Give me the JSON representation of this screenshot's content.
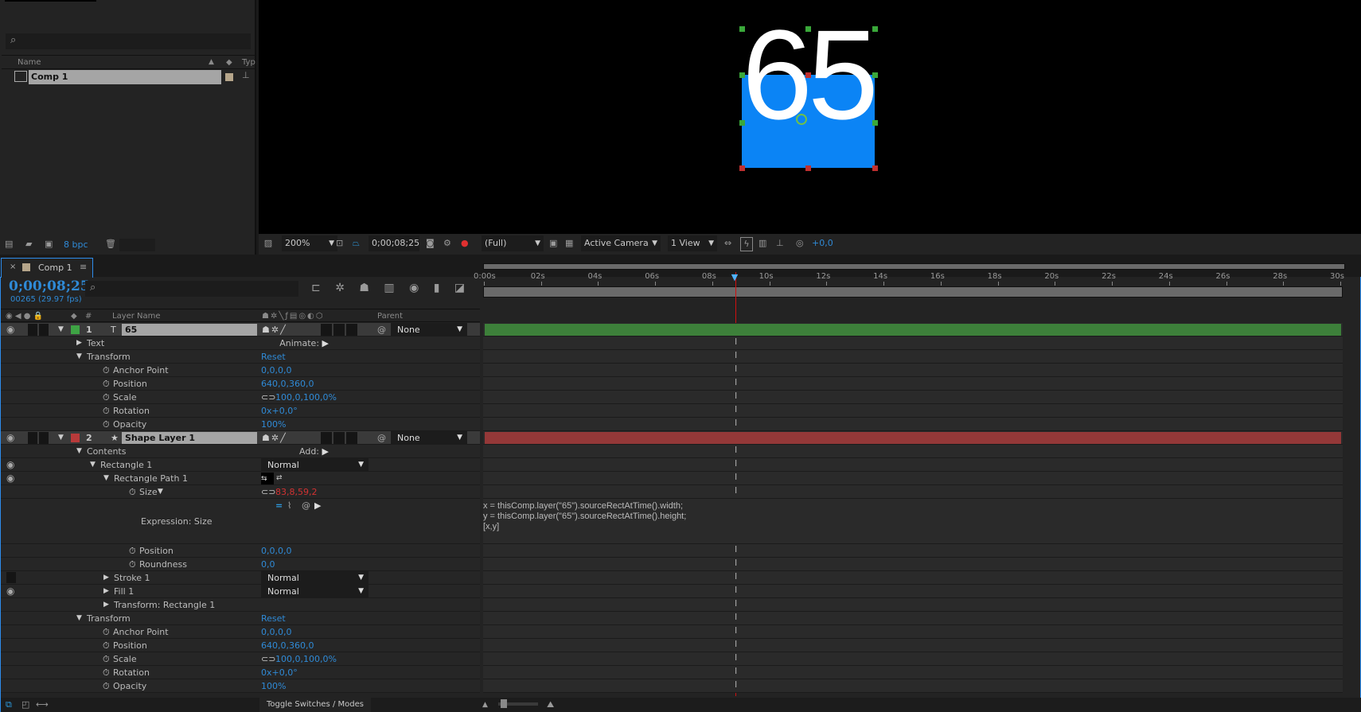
{
  "project": {
    "search_placeholder": "",
    "col_name": "Name",
    "col_type": "Typ",
    "items": [
      {
        "name": "Comp 1",
        "label_color": "#b5a58a"
      }
    ],
    "bpc": "8 bpc"
  },
  "viewer": {
    "comp_text": "65",
    "rect_color": "#0b84f5",
    "magnification": "200%",
    "timecode": "0;00;08;25",
    "resolution": "(Full)",
    "camera": "Active Camera",
    "views": "1 View",
    "exposure": "+0,0"
  },
  "timeline": {
    "tab": "Comp 1",
    "timecode": "0;00;08;25",
    "frames": "00265 (29.97 fps)",
    "headers": {
      "num": "#",
      "layer_name": "Layer Name",
      "parent": "Parent"
    },
    "ruler": [
      "0:00s",
      "02s",
      "04s",
      "06s",
      "08s",
      "10s",
      "12s",
      "14s",
      "16s",
      "18s",
      "20s",
      "22s",
      "24s",
      "26s",
      "28s",
      "30s"
    ],
    "duration_s": 30,
    "current_time_s": 8.83,
    "rows": [
      {
        "kind": "layer",
        "num": "1",
        "name": "65",
        "icon": "text-icon",
        "color": "#3ea344",
        "parent": "None"
      },
      {
        "kind": "group",
        "indent": 0,
        "twirl": "right",
        "label": "Text",
        "action": "Animate:"
      },
      {
        "kind": "group",
        "indent": 0,
        "twirl": "down",
        "label": "Transform",
        "reset": "Reset"
      },
      {
        "kind": "prop",
        "indent": 1,
        "label": "Anchor Point",
        "value": "0,0,0,0"
      },
      {
        "kind": "prop",
        "indent": 1,
        "label": "Position",
        "value": "640,0,360,0"
      },
      {
        "kind": "prop",
        "indent": 1,
        "label": "Scale",
        "value": "100,0,100,0%",
        "link": true
      },
      {
        "kind": "prop",
        "indent": 1,
        "label": "Rotation",
        "value": "0x+0,0°"
      },
      {
        "kind": "prop",
        "indent": 1,
        "label": "Opacity",
        "value": "100%"
      },
      {
        "kind": "layer",
        "num": "2",
        "name": "Shape Layer 1",
        "icon": "star-icon",
        "color": "#b83a3a",
        "parent": "None"
      },
      {
        "kind": "group",
        "indent": 0,
        "twirl": "down",
        "label": "Contents",
        "action": "Add:"
      },
      {
        "kind": "group",
        "indent": 1,
        "twirl": "down",
        "label": "Rectangle 1",
        "mode": "Normal",
        "eye": true
      },
      {
        "kind": "group",
        "indent": 2,
        "twirl": "down",
        "label": "Rectangle Path 1",
        "eye": true,
        "pathdir": true
      },
      {
        "kind": "prop",
        "indent": 3,
        "twirl": "down",
        "label": "Size",
        "value": "83,8,59,2",
        "link": true,
        "red": true
      },
      {
        "kind": "expr",
        "label": "Expression: Size",
        "code": [
          "x = thisComp.layer(\"65\").sourceRectAtTime().width;",
          "y = thisComp.layer(\"65\").sourceRectAtTime().height;",
          "[x,y]"
        ]
      },
      {
        "kind": "prop",
        "indent": 3,
        "label": "Position",
        "value": "0,0,0,0"
      },
      {
        "kind": "prop",
        "indent": 3,
        "label": "Roundness",
        "value": "0,0"
      },
      {
        "kind": "group",
        "indent": 2,
        "twirl": "right",
        "label": "Stroke 1",
        "mode": "Normal",
        "eyebox": true
      },
      {
        "kind": "group",
        "indent": 2,
        "twirl": "right",
        "label": "Fill 1",
        "mode": "Normal",
        "eye": true
      },
      {
        "kind": "group",
        "indent": 2,
        "twirl": "right",
        "label": "Transform: Rectangle 1"
      },
      {
        "kind": "group",
        "indent": 0,
        "twirl": "down",
        "label": "Transform",
        "reset": "Reset"
      },
      {
        "kind": "prop",
        "indent": 1,
        "label": "Anchor Point",
        "value": "0,0,0,0"
      },
      {
        "kind": "prop",
        "indent": 1,
        "label": "Position",
        "value": "640,0,360,0"
      },
      {
        "kind": "prop",
        "indent": 1,
        "label": "Scale",
        "value": "100,0,100,0%",
        "link": true
      },
      {
        "kind": "prop",
        "indent": 1,
        "label": "Rotation",
        "value": "0x+0,0°"
      },
      {
        "kind": "prop",
        "indent": 1,
        "label": "Opacity",
        "value": "100%"
      }
    ],
    "toggle_label": "Toggle Switches / Modes"
  }
}
